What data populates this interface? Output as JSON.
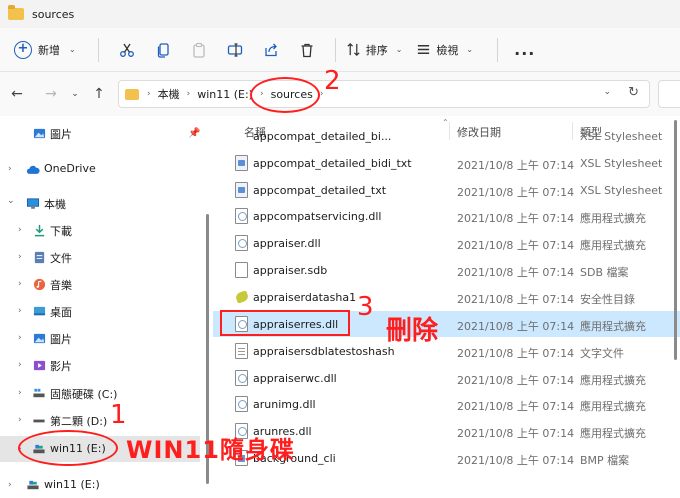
{
  "window": {
    "title": "sources"
  },
  "toolbar": {
    "new_label": "新增",
    "sort_label": "排序",
    "view_label": "檢視",
    "more_label": "..."
  },
  "address": {
    "crumbs": [
      "本機",
      "win11 (E:)",
      "sources"
    ]
  },
  "sidebar": {
    "items": [
      {
        "label": "圖片",
        "icon": "pictures-icon"
      },
      {
        "label": "OneDrive",
        "icon": "cloud-icon"
      },
      {
        "label": "本機",
        "icon": "computer-icon"
      },
      {
        "label": "下載",
        "icon": "download-icon"
      },
      {
        "label": "文件",
        "icon": "document-icon"
      },
      {
        "label": "音樂",
        "icon": "music-icon"
      },
      {
        "label": "桌面",
        "icon": "desktop-icon"
      },
      {
        "label": "圖片",
        "icon": "pictures-icon"
      },
      {
        "label": "影片",
        "icon": "video-icon"
      },
      {
        "label": "固態硬碟 (C:)",
        "icon": "drive-icon"
      },
      {
        "label": "第二顆 (D:)",
        "icon": "drive-icon"
      },
      {
        "label": "win11 (E:)",
        "icon": "usb-drive-icon"
      },
      {
        "label": "win11 (E:)",
        "icon": "usb-drive-icon"
      }
    ]
  },
  "columns": {
    "name": "名稱",
    "date": "修改日期",
    "type": "類型"
  },
  "files": [
    {
      "name": "appcompat_detailed_bidi_txt",
      "date": "2021/10/8 上午 07:14",
      "type": "XSL Stylesheet",
      "icon": "xsl"
    },
    {
      "name": "appcompat_detailed_txt",
      "date": "2021/10/8 上午 07:14",
      "type": "XSL Stylesheet",
      "icon": "xsl"
    },
    {
      "name": "appcompatservicing.dll",
      "date": "2021/10/8 上午 07:14",
      "type": "應用程式擴充",
      "icon": "dll"
    },
    {
      "name": "appraiser.dll",
      "date": "2021/10/8 上午 07:14",
      "type": "應用程式擴充",
      "icon": "dll"
    },
    {
      "name": "appraiser.sdb",
      "date": "2021/10/8 上午 07:14",
      "type": "SDB 檔案",
      "icon": "blank"
    },
    {
      "name": "appraiserdatasha1",
      "date": "2021/10/8 上午 07:14",
      "type": "安全性目錄",
      "icon": "cat"
    },
    {
      "name": "appraiserres.dll",
      "date": "2021/10/8 上午 07:14",
      "type": "應用程式擴充",
      "icon": "dll"
    },
    {
      "name": "appraisersdblatestoshash",
      "date": "2021/10/8 上午 07:14",
      "type": "文字文件",
      "icon": "txt"
    },
    {
      "name": "appraiserwc.dll",
      "date": "2021/10/8 上午 07:14",
      "type": "應用程式擴充",
      "icon": "dll"
    },
    {
      "name": "arunimg.dll",
      "date": "2021/10/8 上午 07:14",
      "type": "應用程式擴充",
      "icon": "dll"
    },
    {
      "name": "arunres.dll",
      "date": "2021/10/8 上午 07:14",
      "type": "應用程式擴充",
      "icon": "dll"
    },
    {
      "name": "background_cli",
      "date": "2021/10/8 上午 07:14",
      "type": "BMP 檔案",
      "icon": "bmp"
    }
  ],
  "partial_top_row": {
    "name": "appcompat_detailed_bi...",
    "type": "XSL Stylesheet"
  },
  "annotations": {
    "step1_number": "1",
    "step1_text": "WIN11隨身碟",
    "step2_number": "2",
    "step3_number": "3",
    "step3_text": "刪除",
    "color": "#ff1e1e"
  },
  "selection_color": "#cce8ff"
}
